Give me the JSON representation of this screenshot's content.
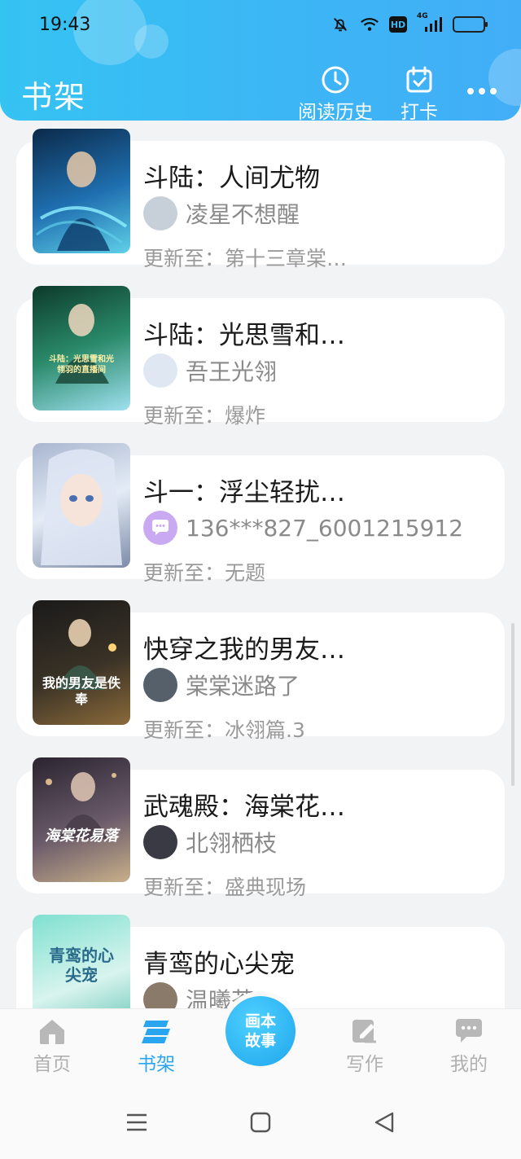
{
  "status_bar": {
    "time": "19:43",
    "icons": [
      "mute-bell-icon",
      "wifi-icon",
      "hd-icon",
      "4g-signal-icon",
      "battery-icon"
    ],
    "hd_label": "HD",
    "network_label": "4G"
  },
  "header": {
    "title": "书架",
    "history_label": "阅读历史",
    "checkin_label": "打卡",
    "accent": "#3cb6f5"
  },
  "books": [
    {
      "title": "斗陆：人间尤物",
      "author": "凌星不想醒",
      "update": "更新至：第十三章棠…",
      "cover_colors": [
        "#0b2a4a",
        "#1f6fb0",
        "#5fd0e8"
      ],
      "avatar_color": "#c7d0d8"
    },
    {
      "title": "斗陆：光思雪和…",
      "author": "吾王光翎",
      "update": "更新至：爆炸",
      "cover_colors": [
        "#0d3a2a",
        "#2a8a6a",
        "#9fe0f0"
      ],
      "cover_text": "斗陆：光思雪和光翎羽的直播间",
      "avatar_color": "#dfe8f2"
    },
    {
      "title": "斗一：浮尘轻扰…",
      "author": "136***827_6001215912",
      "update": "更新至：无题",
      "cover_colors": [
        "#a9b6cf",
        "#e4ecf6",
        "#7d8aa8"
      ],
      "avatar_color": "#c9a9f2"
    },
    {
      "title": "快穿之我的男友…",
      "author": "棠棠迷路了",
      "update": "更新至：冰翎篇.3",
      "cover_colors": [
        "#1a1a1a",
        "#3a3226",
        "#8a6a3a"
      ],
      "cover_text": "我的男友是佚奉",
      "avatar_color": "#55606a"
    },
    {
      "title": "武魂殿：海棠花…",
      "author": "北翎栖枝",
      "update": "更新至：盛典现场",
      "cover_colors": [
        "#2a2430",
        "#6a5a6a",
        "#c8b08a"
      ],
      "cover_text": "海棠花易落",
      "avatar_color": "#3a3a44"
    },
    {
      "title": "青鸾的心尖宠",
      "author": "温曦茶",
      "update": "",
      "cover_colors": [
        "#7fe0d0",
        "#d8f4ee",
        "#5cc0b0"
      ],
      "cover_text": "青鸾的心尖宠",
      "avatar_color": "#8a7a6a"
    }
  ],
  "bottom_nav": {
    "items": [
      {
        "label": "首页",
        "icon": "home-icon"
      },
      {
        "label": "书架",
        "icon": "bookshelf-icon",
        "active": true
      },
      {
        "label": "写作",
        "icon": "pen-icon"
      },
      {
        "label": "我的",
        "icon": "chat-bubble-icon"
      }
    ],
    "center_line1": "画本",
    "center_line2": "故事",
    "active_color": "#2aa6f0",
    "inactive_color": "#b0b0b0"
  },
  "system_nav": [
    "menu-icon",
    "home-square-icon",
    "back-triangle-icon"
  ]
}
